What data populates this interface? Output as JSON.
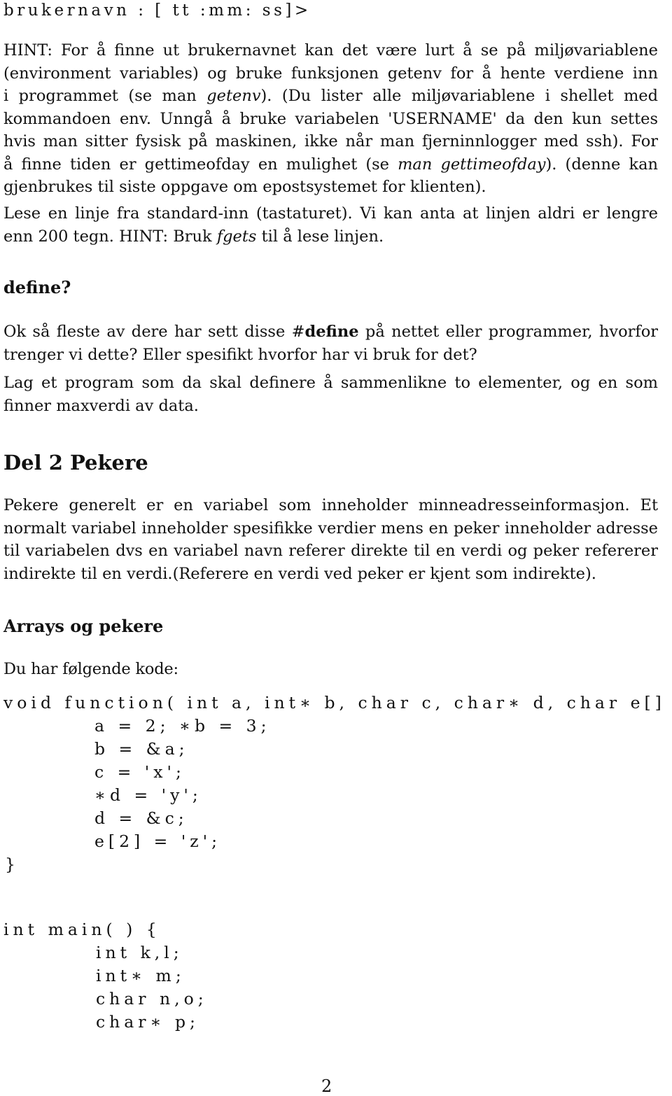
{
  "prompt_format": "brukernavn : [ tt :mm: ss]>",
  "hint_paragraph": {
    "lines": [
      [
        "HINT: For å finne ut brukernavnet kan det være lurt å se på miljøvariablene"
      ],
      [
        "(environment variables) og bruke funksjonen getenv for å hente verdiene inn"
      ],
      [
        "i programmet (se man ",
        "getenv",
        "). (Du lister alle miljøvariablene i shellet med"
      ],
      [
        "kommandoen env. Unngå å bruke variabelen 'USERNAME' da den kun settes"
      ],
      [
        "hvis man sitter fysisk på maskinen, ikke når man fjerninnlogger med ssh). For"
      ],
      [
        "å finne tiden er gettimeofday en mulighet (se ",
        "man gettimeofday",
        "). (denne kan"
      ],
      [
        "gjenbrukes til siste oppgave om epostsystemet for klienten)."
      ]
    ]
  },
  "read_paragraph": {
    "lines": [
      [
        "Lese en linje fra standard-inn (tastaturet). Vi kan anta at linjen aldri er lengre"
      ],
      [
        "enn 200 tegn. HINT: Bruk ",
        "fgets",
        " til å lese linjen."
      ]
    ]
  },
  "define_heading": "define?",
  "define_paragraph1": {
    "lines": [
      [
        "Ok så fleste av dere har sett disse #",
        "define",
        " på nettet eller programmer, hvorfor"
      ],
      [
        "trenger vi dette? Eller spesifikt hvorfor har vi bruk for det?"
      ]
    ]
  },
  "define_paragraph2": {
    "lines": [
      [
        "Lag et program som da skal definere å sammenlikne to elementer, og en som"
      ],
      [
        "finner maxverdi av data."
      ]
    ]
  },
  "section_heading": "Del 2 Pekere",
  "pointer_paragraph": {
    "lines": [
      [
        "Pekere generelt er en variabel som inneholder minneadresseinformasjon. Et"
      ],
      [
        "normalt variabel inneholder spesifikke verdier mens en peker inneholder adresse"
      ],
      [
        "til variabelen dvs en variabel navn referer direkte til en verdi og peker refererer"
      ],
      [
        "indirekte til en verdi.(Referere en verdi ved peker er kjent som indirekte)."
      ]
    ]
  },
  "arrays_heading": "Arrays og pekere",
  "code_intro": "Du har følgende kode:",
  "code_function": {
    "signature": "void function( int a, int∗ b, char c, char∗ d, char e[] ) {",
    "body": [
      "a = 2; ∗b = 3;",
      "b = &a;",
      "c = 'x';",
      "∗d = 'y';",
      "d = &c;",
      "e[2] = 'z';"
    ],
    "close": "}"
  },
  "code_main": {
    "signature": "int main( ) {",
    "body": [
      "int k,l;",
      "int∗ m;",
      "char n,o;",
      "char∗ p;"
    ]
  },
  "page_number": "2"
}
